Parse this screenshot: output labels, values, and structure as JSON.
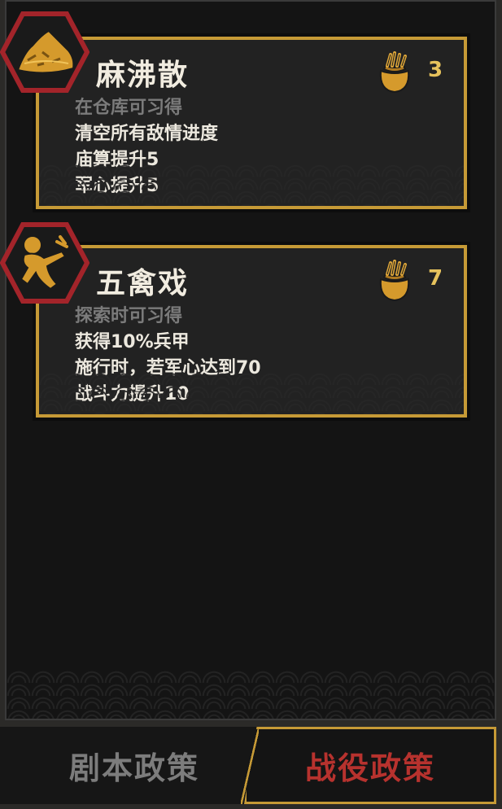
{
  "policies": [
    {
      "name": "麻沸散",
      "icon": "medicine-pile-icon",
      "cost_icon": "grain-sack-icon",
      "cost": "3",
      "requirement": "在仓库可习得",
      "effects": [
        "清空所有敌情进度",
        "庙算提升5",
        "军心提升5"
      ]
    },
    {
      "name": "五禽戏",
      "icon": "martial-artist-icon",
      "cost_icon": "grain-sack-icon",
      "cost": "7",
      "requirement": "探索时可习得",
      "effects": [
        "获得10%兵甲",
        "施行时，若军心达到70",
        "战斗力提升10"
      ]
    }
  ],
  "tabs": {
    "script_policy": "剧本政策",
    "campaign_policy": "战役政策",
    "active": "campaign_policy"
  },
  "colors": {
    "gold_border": "#c69a36",
    "hex_red": "#a3242a",
    "active_tab_text": "#b7322e",
    "inactive_tab_text": "#7c7c7c",
    "cost_text": "#e6c25c"
  }
}
